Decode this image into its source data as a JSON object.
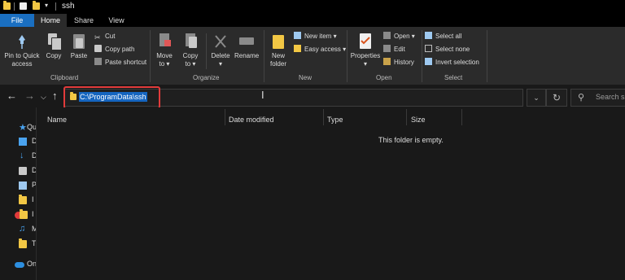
{
  "window": {
    "title": "ssh"
  },
  "tabs": [
    {
      "label": "File"
    },
    {
      "label": "Home"
    },
    {
      "label": "Share"
    },
    {
      "label": "View"
    }
  ],
  "ribbon": {
    "clipboard": {
      "pin_label_1": "Pin to Quick",
      "pin_label_2": "access",
      "copy": "Copy",
      "paste": "Paste",
      "cut": "Cut",
      "copy_path": "Copy path",
      "paste_shortcut": "Paste shortcut",
      "group_label": "Clipboard"
    },
    "organize": {
      "move_to_1": "Move",
      "move_to_2": "to",
      "copy_to_1": "Copy",
      "copy_to_2": "to",
      "delete": "Delete",
      "rename": "Rename",
      "group_label": "Organize"
    },
    "new": {
      "new_folder_1": "New",
      "new_folder_2": "folder",
      "new_item": "New item",
      "easy_access": "Easy access",
      "group_label": "New"
    },
    "open": {
      "properties": "Properties",
      "open": "Open",
      "edit": "Edit",
      "history": "History",
      "group_label": "Open"
    },
    "select": {
      "select_all": "Select all",
      "select_none": "Select none",
      "invert_selection": "Invert selection",
      "group_label": "Select"
    }
  },
  "address": {
    "path": "C:\\ProgramData\\ssh"
  },
  "search": {
    "placeholder": "Search ss"
  },
  "nav_pane": {
    "items": [
      {
        "label": "Qu"
      },
      {
        "label": "D"
      },
      {
        "label": "D"
      },
      {
        "label": "D"
      },
      {
        "label": "P"
      },
      {
        "label": "I"
      },
      {
        "label": "I"
      },
      {
        "label": "M"
      },
      {
        "label": "T"
      },
      {
        "label": "On"
      }
    ]
  },
  "columns": [
    {
      "label": "Name"
    },
    {
      "label": "Date modified"
    },
    {
      "label": "Type"
    },
    {
      "label": "Size"
    }
  ],
  "content": {
    "empty_message": "This folder is empty."
  },
  "colors": {
    "file_tab": "#1a6fc1",
    "highlight": "#1565c0",
    "callout": "#e23b3b",
    "folder": "#f2c744"
  }
}
